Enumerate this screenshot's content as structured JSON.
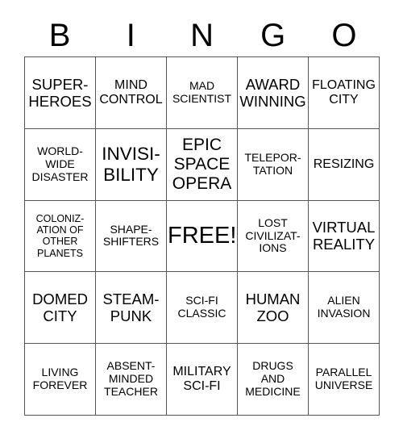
{
  "card": {
    "title": "BINGO",
    "header_letters": [
      "B",
      "I",
      "N",
      "G",
      "O"
    ],
    "free_space_label": "FREE!",
    "colors": {
      "background": "#ffffff",
      "text": "#000000",
      "grid_line": "#555555"
    },
    "grid": {
      "columns": 5,
      "rows": 5,
      "cells": [
        {
          "text": "SUPER-\nHEROES",
          "size": "lg",
          "free": false
        },
        {
          "text": "MIND\nCONTROL",
          "size": "md",
          "free": false
        },
        {
          "text": "MAD\nSCIENTIST",
          "size": "sm",
          "free": false
        },
        {
          "text": "AWARD\nWINNING",
          "size": "lg",
          "free": false
        },
        {
          "text": "FLOATING\nCITY",
          "size": "md",
          "free": false
        },
        {
          "text": "WORLD-\nWIDE\nDISASTER",
          "size": "sm",
          "free": false
        },
        {
          "text": "INVISI-\nBILITY",
          "size": "xxl",
          "free": false
        },
        {
          "text": "EPIC\nSPACE\nOPERA",
          "size": "xl",
          "free": false
        },
        {
          "text": "TELEPOR-\nTATION",
          "size": "sm",
          "free": false
        },
        {
          "text": "RESIZING",
          "size": "md",
          "free": false
        },
        {
          "text": "COLONIZ-\nATION OF\nOTHER\nPLANETS",
          "size": "xs",
          "free": false
        },
        {
          "text": "SHAPE-\nSHIFTERS",
          "size": "sm",
          "free": false
        },
        {
          "text": "FREE!",
          "size": "free",
          "free": true
        },
        {
          "text": "LOST\nCIVILIZAT-\nIONS",
          "size": "sm",
          "free": false
        },
        {
          "text": "VIRTUAL\nREALITY",
          "size": "lg",
          "free": false
        },
        {
          "text": "DOMED\nCITY",
          "size": "lg",
          "free": false
        },
        {
          "text": "STEAM-\nPUNK",
          "size": "lg",
          "free": false
        },
        {
          "text": "SCI-FI\nCLASSIC",
          "size": "sm",
          "free": false
        },
        {
          "text": "HUMAN\nZOO",
          "size": "lg",
          "free": false
        },
        {
          "text": "ALIEN\nINVASION",
          "size": "sm",
          "free": false
        },
        {
          "text": "LIVING\nFOREVER",
          "size": "sm",
          "free": false
        },
        {
          "text": "ABSENT-\nMINDED\nTEACHER",
          "size": "sm",
          "free": false
        },
        {
          "text": "MILITARY\nSCI-FI",
          "size": "md",
          "free": false
        },
        {
          "text": "DRUGS\nAND\nMEDICINE",
          "size": "sm",
          "free": false
        },
        {
          "text": "PARALLEL\nUNIVERSE",
          "size": "sm",
          "free": false
        }
      ]
    }
  }
}
